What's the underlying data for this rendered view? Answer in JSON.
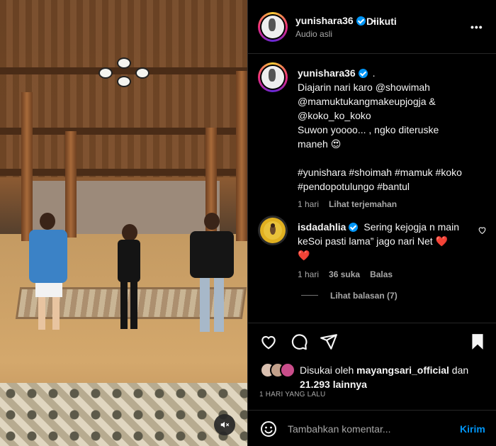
{
  "post": {
    "author": "yunishara36",
    "follow_status": "Diikuti",
    "separator": "•",
    "audio": "Audio asli",
    "more": "•••",
    "caption_dot": ".",
    "caption_lines": [
      "Diajarin nari karo @showimah",
      "@mamuktukangmakeupjogja &",
      "@koko_ko_koko",
      "Suwon yoooo... , ngko diteruske",
      "maneh 😍",
      "",
      "#yunishara #shoimah #mamuk #koko",
      "#pendopotulungo #bantul"
    ],
    "caption_time": "1 hari",
    "see_translation": "Lihat terjemahan"
  },
  "comment": {
    "author": "isdadahlia",
    "text_lines": [
      "Sering kejogja n main",
      "keSoi pasti lama” jago nari Net ❤️",
      "❤️"
    ],
    "time": "1 hari",
    "likes": "36 suka",
    "reply": "Balas",
    "view_replies": "Lihat balasan (7)"
  },
  "engagement": {
    "liked_by_prefix": "Disukai oleh",
    "liked_by_user": "mayangsari_official",
    "liked_by_and": "dan",
    "others_count": "21.293 lainnya",
    "timestamp": "1 HARI YANG LALU"
  },
  "composer": {
    "placeholder": "Tambahkan komentar...",
    "send": "Kirim"
  },
  "icons": {
    "like": "heart-icon",
    "comment": "comment-icon",
    "share": "send-icon",
    "save": "bookmark-icon",
    "emoji": "emoji-icon",
    "mute": "speaker-muted-icon"
  },
  "colors": {
    "verified": "#0095f6",
    "send_button": "#0095f6",
    "heart_emoji": "#ff2a4b"
  }
}
